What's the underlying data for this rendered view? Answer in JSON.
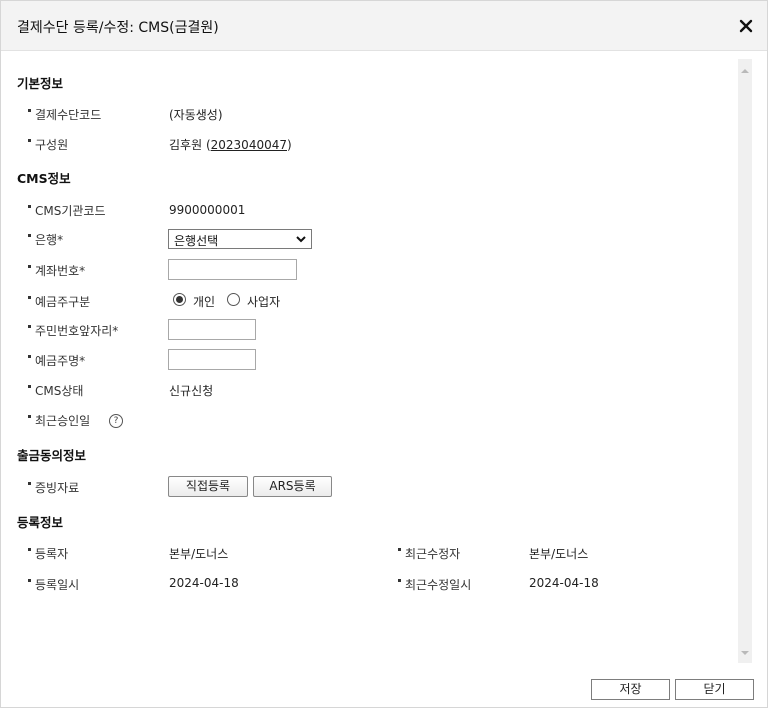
{
  "dialog": {
    "title": "결제수단 등록/수정: CMS(금결원)",
    "close_icon": "close-icon"
  },
  "basic": {
    "section_title": "기본정보",
    "code_label": "결제수단코드",
    "code_value": "(자동생성)",
    "member_label": "구성원",
    "member_name": "김후원",
    "member_open": "(",
    "member_id": "2023040047",
    "member_close": ")"
  },
  "cms": {
    "section_title": "CMS정보",
    "org_code_label": "CMS기관코드",
    "org_code_value": "9900000001",
    "bank_label": "은행*",
    "bank_selected": "은행선택",
    "account_label": "계좌번호*",
    "account_value": "",
    "holder_type_label": "예금주구분",
    "holder_type_options": [
      "개인",
      "사업자"
    ],
    "holder_type_selected": "개인",
    "ssn_label": "주민번호앞자리*",
    "ssn_value": "",
    "holder_name_label": "예금주명*",
    "holder_name_value": "",
    "status_label": "CMS상태",
    "status_value": "신규신청",
    "approved_label": "최근승인일",
    "help_glyph": "?"
  },
  "consent": {
    "section_title": "출금동의정보",
    "evidence_label": "증빙자료",
    "direct_button": "직접등록",
    "ars_button": "ARS등록"
  },
  "registration": {
    "section_title": "등록정보",
    "registrant_label": "등록자",
    "registrant_value": "본부/도너스",
    "modifier_label": "최근수정자",
    "modifier_value": "본부/도너스",
    "registered_at_label": "등록일시",
    "registered_at_value": "2024-04-18",
    "modified_at_label": "최근수정일시",
    "modified_at_value": "2024-04-18"
  },
  "footer": {
    "save_label": "저장",
    "close_label": "닫기"
  },
  "colors": {
    "titlebar_bg": "#f3f3f3",
    "body_bg": "#ffffff",
    "border": "#7d7d7d"
  }
}
